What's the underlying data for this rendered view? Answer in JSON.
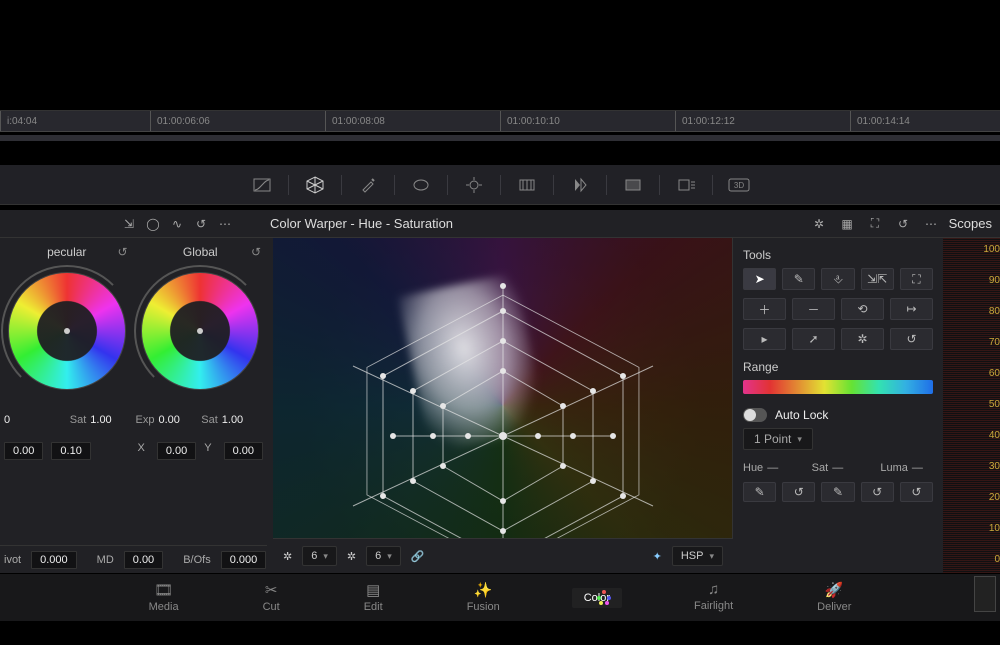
{
  "timeline": {
    "ticks": [
      "i:04:04",
      "01:00:06:06",
      "01:00:08:08",
      "01:00:10:10",
      "01:00:12:12",
      "01:00:14:14"
    ],
    "tick_positions": [
      0,
      150,
      325,
      500,
      675,
      850
    ]
  },
  "toolbar_icons": [
    "curves-icon",
    "warper-icon",
    "picker-icon",
    "window-icon",
    "tracker-icon",
    "blur-icon",
    "key-icon",
    "sizing-icon",
    "deflicker-icon",
    "3d-icon"
  ],
  "header": {
    "title": "Color Warper - Hue - Saturation",
    "scopes_label": "Scopes",
    "left_icons": [
      "expand-icon",
      "record-icon",
      "waveform-icon",
      "reset-icon",
      "more-icon"
    ],
    "right_icons": [
      "warper-icon",
      "grid-icon",
      "fullscreen-icon",
      "reset-icon",
      "more-icon"
    ]
  },
  "wheels": {
    "left_label": "pecular",
    "right_label": "Global",
    "params": {
      "left": {
        "p1": "0",
        "p2_label": "Sat",
        "p2": "1.00"
      },
      "right": {
        "p1_label": "Exp",
        "p1": "0.00",
        "p2_label": "Sat",
        "p2": "1.00"
      }
    },
    "numrow_left": {
      "a": "0.00",
      "b": "0.10",
      "x_label": "X",
      "x": "0.00",
      "y_label": "Y",
      "y": "0.00"
    },
    "footer": {
      "ivot_label": "ivot",
      "ivot": "0.000",
      "md_label": "MD",
      "md": "0.00",
      "bofs_label": "B/Ofs",
      "bofs": "0.000"
    }
  },
  "warper_footer": {
    "rings": "6",
    "spokes": "6",
    "space": "HSP"
  },
  "tools": {
    "title": "Tools",
    "row1": [
      "select",
      "pin",
      "pin-column",
      "converge",
      "diverge"
    ],
    "row2": [
      "add",
      "remove",
      "rotate",
      "arrow"
    ],
    "row3": [
      "select-ring",
      "select-spoke",
      "invert",
      "reset"
    ],
    "range_label": "Range",
    "autolock_label": "Auto Lock",
    "dropdown": "1 Point",
    "hsl": {
      "hue": "Hue",
      "sat": "Sat",
      "luma": "Luma"
    }
  },
  "scopes": {
    "scale": [
      "100",
      "90",
      "80",
      "70",
      "60",
      "50",
      "40",
      "30",
      "20",
      "10",
      "0"
    ]
  },
  "pages": [
    {
      "id": "media",
      "label": "Media",
      "icon": "🎞"
    },
    {
      "id": "cut",
      "label": "Cut",
      "icon": "✂"
    },
    {
      "id": "edit",
      "label": "Edit",
      "icon": "▤"
    },
    {
      "id": "fusion",
      "label": "Fusion",
      "icon": "✨"
    },
    {
      "id": "color",
      "label": "Color",
      "icon": ""
    },
    {
      "id": "fairlight",
      "label": "Fairlight",
      "icon": "♫"
    },
    {
      "id": "deliver",
      "label": "Deliver",
      "icon": "🚀"
    }
  ]
}
